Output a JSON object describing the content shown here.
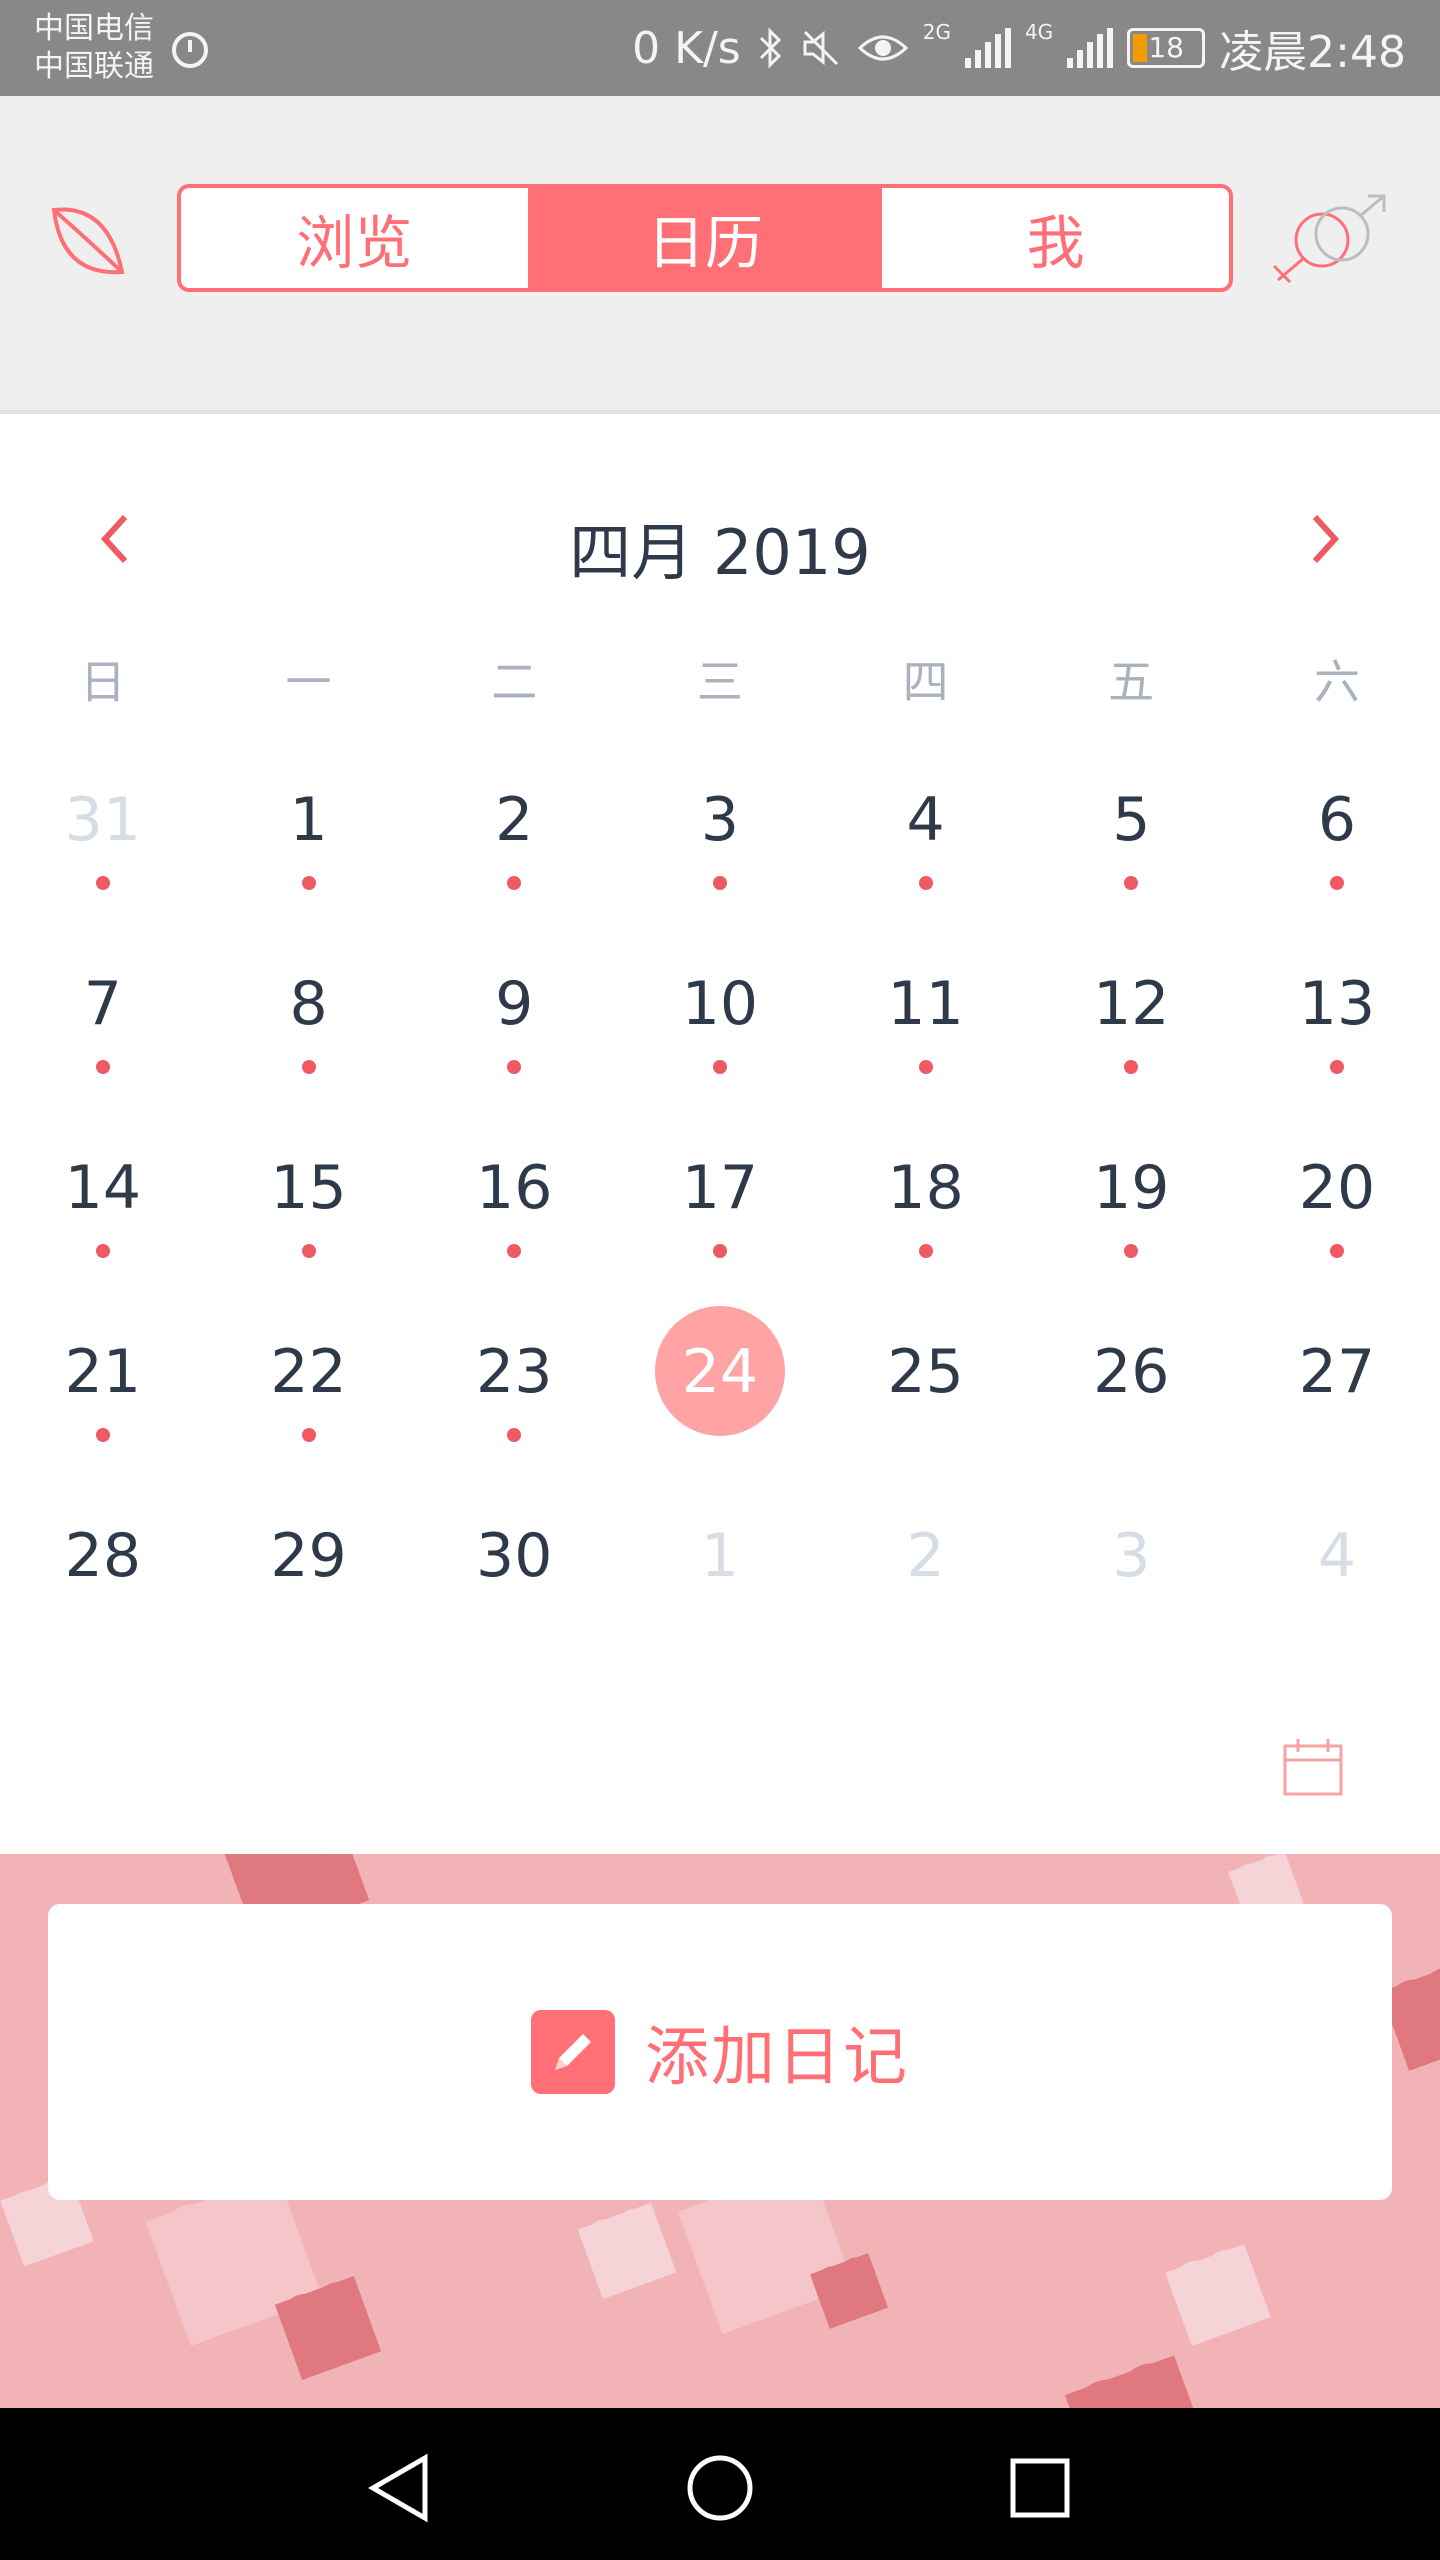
{
  "status_bar": {
    "carrier_1": "中国电信",
    "carrier_2": "中国联通",
    "net_speed": "0 K/s",
    "net_2g": "2G",
    "net_4g": "4G",
    "battery": "18",
    "time": "凌晨2:48"
  },
  "nav": {
    "tabs": [
      {
        "label": "浏览",
        "active": false
      },
      {
        "label": "日历",
        "active": true
      },
      {
        "label": "我",
        "active": false
      }
    ]
  },
  "calendar": {
    "month_title": "四月 2019",
    "weekdays": [
      "日",
      "一",
      "二",
      "三",
      "四",
      "五",
      "六"
    ],
    "weeks": [
      [
        {
          "d": "31",
          "other": true,
          "dot": true
        },
        {
          "d": "1",
          "dot": true
        },
        {
          "d": "2",
          "dot": true
        },
        {
          "d": "3",
          "dot": true
        },
        {
          "d": "4",
          "dot": true
        },
        {
          "d": "5",
          "dot": true
        },
        {
          "d": "6",
          "dot": true
        }
      ],
      [
        {
          "d": "7",
          "dot": true
        },
        {
          "d": "8",
          "dot": true
        },
        {
          "d": "9",
          "dot": true
        },
        {
          "d": "10",
          "dot": true
        },
        {
          "d": "11",
          "dot": true
        },
        {
          "d": "12",
          "dot": true
        },
        {
          "d": "13",
          "dot": true
        }
      ],
      [
        {
          "d": "14",
          "dot": true
        },
        {
          "d": "15",
          "dot": true
        },
        {
          "d": "16",
          "dot": true
        },
        {
          "d": "17",
          "dot": true
        },
        {
          "d": "18",
          "dot": true
        },
        {
          "d": "19",
          "dot": true
        },
        {
          "d": "20",
          "dot": true
        }
      ],
      [
        {
          "d": "21",
          "dot": true
        },
        {
          "d": "22",
          "dot": true
        },
        {
          "d": "23",
          "dot": true
        },
        {
          "d": "24",
          "today": true
        },
        {
          "d": "25"
        },
        {
          "d": "26"
        },
        {
          "d": "27"
        }
      ],
      [
        {
          "d": "28"
        },
        {
          "d": "29"
        },
        {
          "d": "30"
        },
        {
          "d": "1",
          "other": true
        },
        {
          "d": "2",
          "other": true
        },
        {
          "d": "3",
          "other": true
        },
        {
          "d": "4",
          "other": true
        }
      ]
    ]
  },
  "diary": {
    "add_label": "添加日记"
  },
  "colors": {
    "accent": "#ff6f75",
    "today_circle": "#ffa3a5",
    "dot": "#ef5a62",
    "hearts_bg": "#f2b3b7"
  }
}
